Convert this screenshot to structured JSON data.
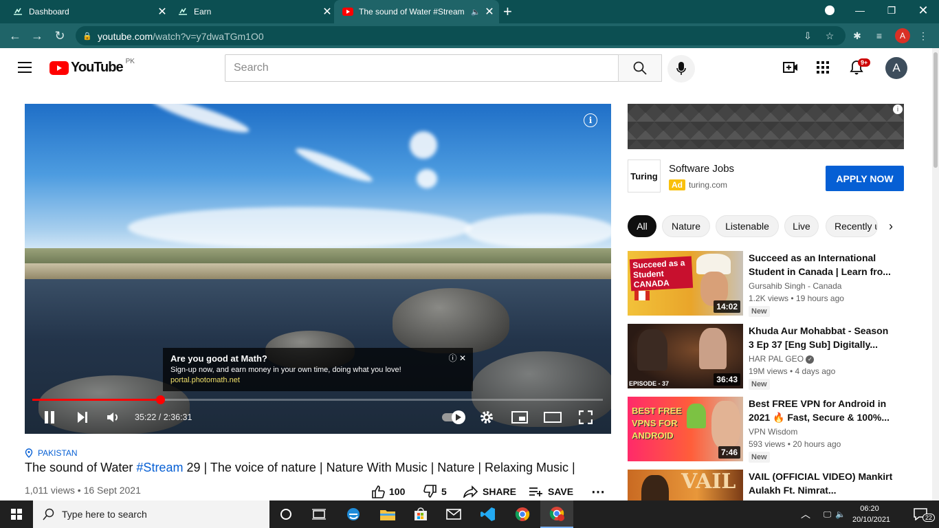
{
  "browser": {
    "tabs": [
      {
        "title": "Dashboard"
      },
      {
        "title": "Earn"
      },
      {
        "title": "The sound of Water #Stream"
      }
    ],
    "url_host": "youtube.com",
    "url_path": "/watch?v=y7dwaTGm1O0",
    "profile_letter": "A"
  },
  "youtube": {
    "logo_text": "YouTube",
    "country_code": "PK",
    "search_placeholder": "Search",
    "notif_count": "9+",
    "avatar_letter": "A"
  },
  "player": {
    "progress": 0.225,
    "time_text": "35:22 / 2:36:31",
    "overlay_ad": {
      "headline": "Are you good at Math?",
      "text": "Sign-up now, and earn money in your own time, doing what you love!",
      "url": "portal.photomath.net"
    }
  },
  "sponsor": {
    "logo": "Turing",
    "title": "Software Jobs",
    "badge": "Ad",
    "domain": "turing.com",
    "cta": "APPLY NOW"
  },
  "chips": [
    "All",
    "Nature",
    "Listenable",
    "Live",
    "Recently uploaded"
  ],
  "recommendations": [
    {
      "title": "Succeed as an International Student in Canada | Learn fro...",
      "channel": "Gursahib Singh - Canada",
      "meta": "1.2K views • 19 hours ago",
      "badge": "New",
      "duration": "14:02",
      "thumb_text": "Succeed as a Student CANADA"
    },
    {
      "title": "Khuda Aur Mohabbat - Season 3 Ep 37 [Eng Sub] Digitally...",
      "channel": "HAR PAL GEO",
      "meta": "19M views • 4 days ago",
      "badge": "New",
      "duration": "36:43",
      "thumb_text": "EPISODE - 37"
    },
    {
      "title": "Best FREE VPN for Android in 2021 🔥 Fast, Secure & 100%...",
      "channel": "VPN Wisdom",
      "meta": "593 views • 20 hours ago",
      "badge": "New",
      "duration": "7:46",
      "thumb_text": "BEST FREE VPNS FOR ANDROID"
    },
    {
      "title": "VAIL (OFFICIAL VIDEO) Mankirt Aulakh Ft. Nimrat...",
      "channel": "",
      "meta": "",
      "badge": "",
      "duration": "",
      "thumb_text": "VAIL"
    }
  ],
  "video": {
    "location": "PAKISTAN",
    "title_pre": "The sound of Water ",
    "hashtag": "#Stream",
    "title_post": " 29 | The voice of nature | Nature With Music | Nature | Relaxing Music |",
    "views_date": "1,011 views • 16 Sept 2021",
    "likes": "100",
    "dislikes": "5",
    "share_label": "SHARE",
    "save_label": "SAVE"
  },
  "taskbar": {
    "search_placeholder": "Type here to search",
    "time": "06:20",
    "date": "20/10/2021",
    "notif_count": "22"
  },
  "colors": {
    "accent": "#065fd4",
    "progress": "#ff0000",
    "tabbar": "#0c4f52"
  }
}
